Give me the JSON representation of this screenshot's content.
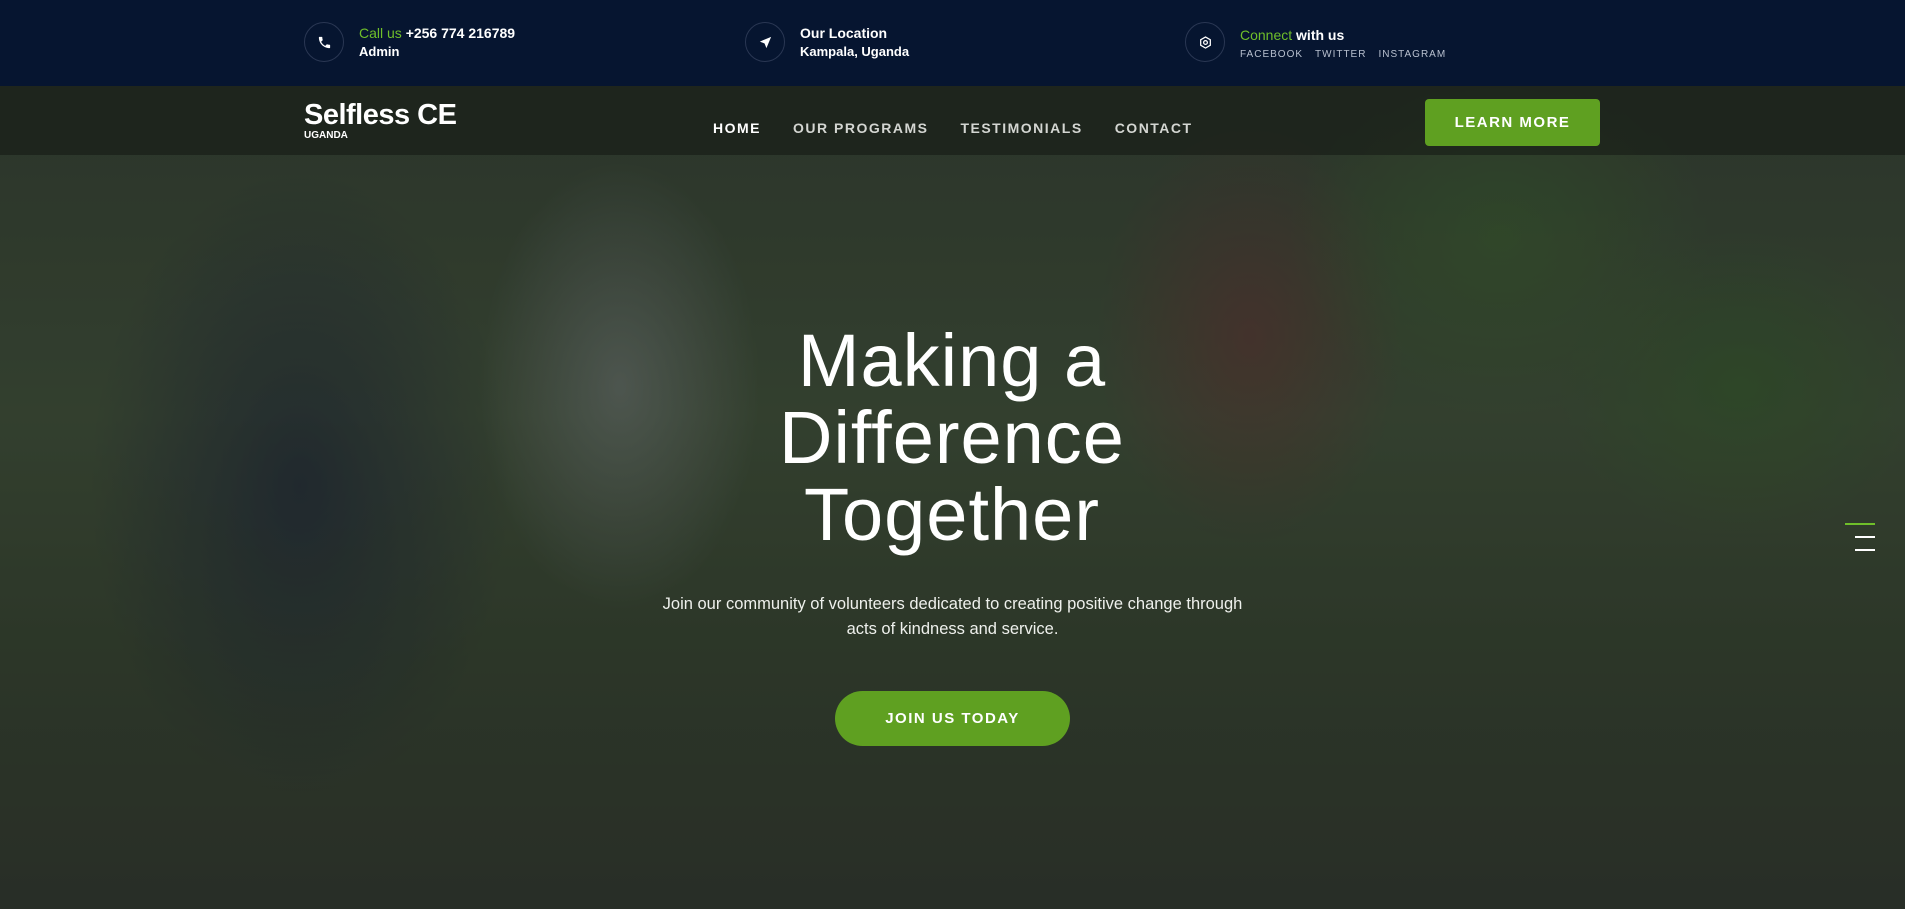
{
  "topbar": {
    "call": {
      "highlight": "Call us",
      "phone": "+256 774 216789",
      "sub": "Admin"
    },
    "location": {
      "title": "Our Location",
      "sub": "Kampala, Uganda"
    },
    "connect": {
      "highlight": "Connect",
      "rest": "with us",
      "social": [
        "FACEBOOK",
        "TWITTER",
        "INSTAGRAM"
      ]
    }
  },
  "nav": {
    "logo_name": "Selfless CE",
    "logo_sub": "UGANDA",
    "items": [
      "HOME",
      "OUR PROGRAMS",
      "TESTIMONIALS",
      "CONTACT"
    ],
    "active_index": 0,
    "cta": "LEARN MORE"
  },
  "hero": {
    "headline_lines": [
      "Making a",
      "Difference",
      "Together"
    ],
    "lead_lines": [
      "Join our community of volunteers dedicated to creating positive change through",
      "acts of kindness and service."
    ],
    "button": "JOIN US TODAY"
  },
  "colors": {
    "accent": "#5fa021",
    "topbar_bg": "#061530"
  }
}
